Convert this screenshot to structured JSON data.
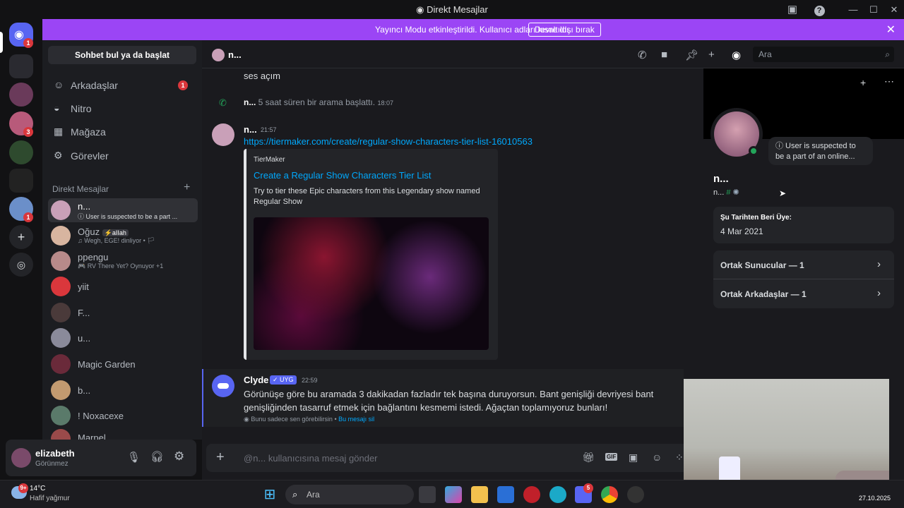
{
  "window": {
    "title": "Direkt Mesajlar"
  },
  "banner": {
    "message": "Yayıncı Modu etkinleştirildi. Kullanıcı adları kısaltıldı.",
    "button": "Devre dışı bırak"
  },
  "servers": {
    "home_badge": "1",
    "badges": [
      "3",
      "1"
    ]
  },
  "sidebar": {
    "search": "Sohbet bul ya da başlat",
    "nav": [
      {
        "label": "Arkadaşlar",
        "badge": "1",
        "icon": "friends-icon"
      },
      {
        "label": "Nitro",
        "icon": "nitro-icon"
      },
      {
        "label": "Mağaza",
        "icon": "shop-icon"
      },
      {
        "label": "Görevler",
        "icon": "quests-icon"
      }
    ],
    "dm_header": "Direkt Mesajlar",
    "dms": [
      {
        "name": "n...",
        "sub": "ⓘ User is suspected to be a part ..."
      },
      {
        "name": "Oğuz",
        "tag": "aIIah",
        "sub": "♫ Wegh, EGE! dinliyor • 🏳"
      },
      {
        "name": "ppengu",
        "sub": "🎮 RV There Yet? Oynuyor +1"
      },
      {
        "name": "yiit",
        "sub": ""
      },
      {
        "name": "F...",
        "sub": ""
      },
      {
        "name": "u...",
        "sub": ""
      },
      {
        "name": "Magic Garden",
        "sub": ""
      },
      {
        "name": "b...",
        "sub": ""
      },
      {
        "name": "! Noxacexe",
        "sub": ""
      },
      {
        "name": "Marpel",
        "sub": ""
      }
    ]
  },
  "user": {
    "name": "elizabeth",
    "status": "Görünmez"
  },
  "chat": {
    "header_name": "n...",
    "search_placeholder": "Ara",
    "messages": {
      "m1": "ses açım",
      "call_user": "n...",
      "call_text": " 5 saat süren bir arama başlattı.",
      "call_time": "18:07",
      "author": "n...",
      "time": "21:57",
      "link": "https://tiermaker.com/create/regular-show-characters-tier-list-16010563",
      "embed_site": "TierMaker",
      "embed_title": "Create a Regular Show Characters Tier List",
      "embed_desc": "Try to tier these Epic characters from this Legendary show named Regular Show",
      "clyde_name": "Clyde",
      "clyde_tag": "✓ UYG",
      "clyde_time": "22:59",
      "clyde_text": "Görünüşe göre bu aramada 3 dakikadan fazladır tek başına duruyorsun. Bant genişliği devriyesi bant genişliğinden tasarruf etmek için bağlantını kesmemi istedi. Ağaçtan toplamıyoruz bunları!",
      "clyde_note": "Bunu sadece sen görebilirsin",
      "clyde_delete": "Bu mesajı sil"
    },
    "composer_placeholder": "@n... kullanıcısına mesaj gönder"
  },
  "profile": {
    "name": "n...",
    "username": "n...",
    "status_note": "ⓘ User is suspected to be a part of an online...",
    "member_since_label": "Şu Tarihten Beri Üye:",
    "member_since": "4 Mar 2021",
    "mutual_servers": "Ortak Sunucular — 1",
    "mutual_friends": "Ortak Arkadaşlar — 1"
  },
  "taskbar": {
    "weather_temp": "14°C",
    "weather_desc": "Hafif yağmur",
    "weather_badge": "9+",
    "search": "Ara",
    "discord_badge": "5",
    "date": "27.10.2025"
  },
  "colors": {
    "accent": "#5865f2",
    "banner": "#9b45f5",
    "online": "#23a55a",
    "danger": "#da373c",
    "link": "#00a8fc"
  }
}
